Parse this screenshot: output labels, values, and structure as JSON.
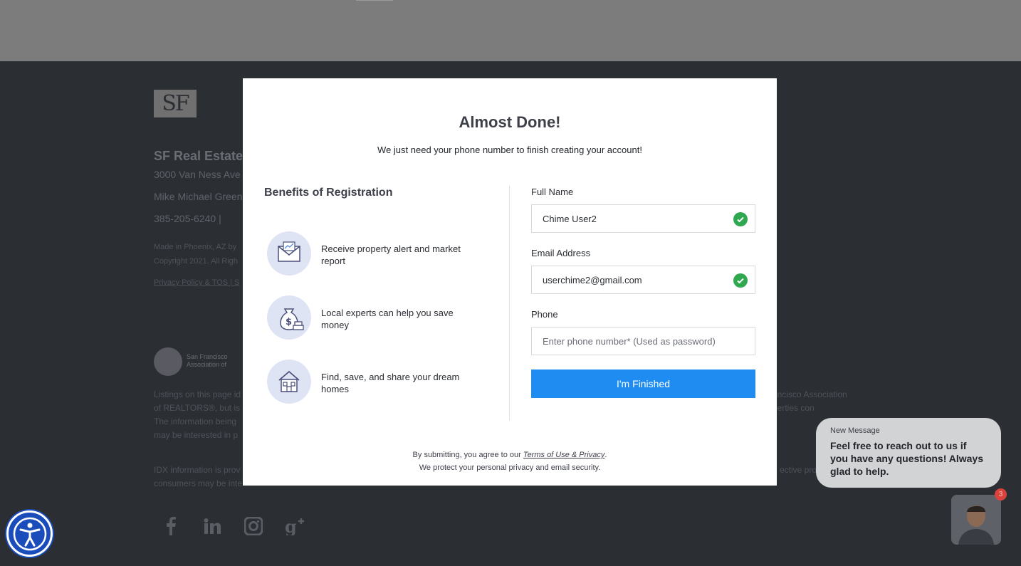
{
  "footer": {
    "logo_text": "SF",
    "brand": "SF Real Estate",
    "address": "3000 Van Ness Ave",
    "agent": "Mike Michael Green",
    "phone": "385-205-6240   |",
    "made_in": "Made in Phoenix, AZ by",
    "copyright": "Copyright 2021. All Righ",
    "links": "Privacy Policy & TOS | S",
    "assoc_text": "San Francisco\nAssociation of",
    "listing_left": "Listings on this page id of REALTORS®, but is The information being may be interested in p",
    "listing_right": "ancisco Association\nperties con",
    "idx_left": "IDX information is prov consumers may be inte",
    "idx_right": "ective pro"
  },
  "modal": {
    "title": "Almost Done!",
    "subtitle": "We just need your phone number to finish creating your account!",
    "benefits_title": "Benefits of Registration",
    "benefits": [
      {
        "icon": "envelope-chart-icon",
        "text": "Receive property alert and market report"
      },
      {
        "icon": "money-bag-icon",
        "text": "Local experts can help you save money"
      },
      {
        "icon": "house-icon",
        "text": "Find, save, and share your dream homes"
      }
    ],
    "full_name_label": "Full Name",
    "full_name_value": "Chime User2",
    "email_label": "Email Address",
    "email_value": "userchime2@gmail.com",
    "phone_label": "Phone",
    "phone_placeholder": "Enter phone number* (Used as password)",
    "submit_label": "I'm Finished",
    "agree_prefix": "By submitting, you agree to our ",
    "agree_link": "Terms of Use & Privacy",
    "agree_suffix": ".",
    "protect_text": "We protect your personal privacy and email security."
  },
  "chat": {
    "new_message": "New Message",
    "message": "Feel free to reach out to us if you have any questions! Always glad to help.",
    "badge": "3"
  },
  "colors": {
    "primary_button": "#1e8cf0",
    "check_green": "#2fa84f",
    "accessibility_blue": "#1a4dbb"
  }
}
